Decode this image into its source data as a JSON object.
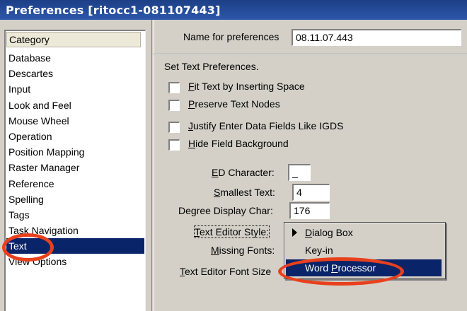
{
  "window": {
    "title": "Preferences [ritocc1-081107443]"
  },
  "category": {
    "header": "Category",
    "items": [
      "Database",
      "Descartes",
      "Input",
      "Look and Feel",
      "Mouse Wheel",
      "Operation",
      "Position Mapping",
      "Raster Manager",
      "Reference",
      "Spelling",
      "Tags",
      "Task Navigation",
      "Text",
      "View Options"
    ],
    "selected": "Text"
  },
  "name_prefs": {
    "label": "Name for preferences",
    "value": "08.11.07.443"
  },
  "text_prefs": {
    "heading": "Set Text Preferences.",
    "checkboxes": [
      {
        "key": "F",
        "rest": "it Text by Inserting Space",
        "checked": false
      },
      {
        "key": "P",
        "rest": "reserve Text Nodes",
        "checked": false
      },
      {
        "key": "J",
        "rest": "ustify Enter Data Fields Like IGDS",
        "checked": false
      },
      {
        "key": "H",
        "rest": "ide Field Background",
        "checked": false
      }
    ],
    "ed_character": {
      "pre": "",
      "key": "E",
      "post": "D Character:",
      "value": "_"
    },
    "smallest_text": {
      "pre": "",
      "key": "S",
      "post": "mallest Text:",
      "value": "4"
    },
    "degree_display": {
      "label": "Degree Display Char:",
      "value": "176"
    },
    "text_editor_style": {
      "pre": "",
      "key": "T",
      "post": "ext Editor Style:"
    },
    "missing_fonts": {
      "pre": "",
      "key": "M",
      "post": "issing Fonts:"
    },
    "text_editor_font_size": {
      "pre": "",
      "key": "T",
      "post": "ext Editor Font Size"
    }
  },
  "dropdown": {
    "options": [
      {
        "key": "D",
        "rest": "ialog Box",
        "marker": "arrow"
      },
      {
        "label": "Key-in"
      },
      {
        "pre": "Word ",
        "key": "P",
        "rest": "rocessor",
        "highlighted": true
      }
    ]
  },
  "colors": {
    "title_bar": "#1c3f86",
    "selection": "#0a246a",
    "highlight_ring": "#e8401c",
    "face": "#d4d0c8"
  }
}
